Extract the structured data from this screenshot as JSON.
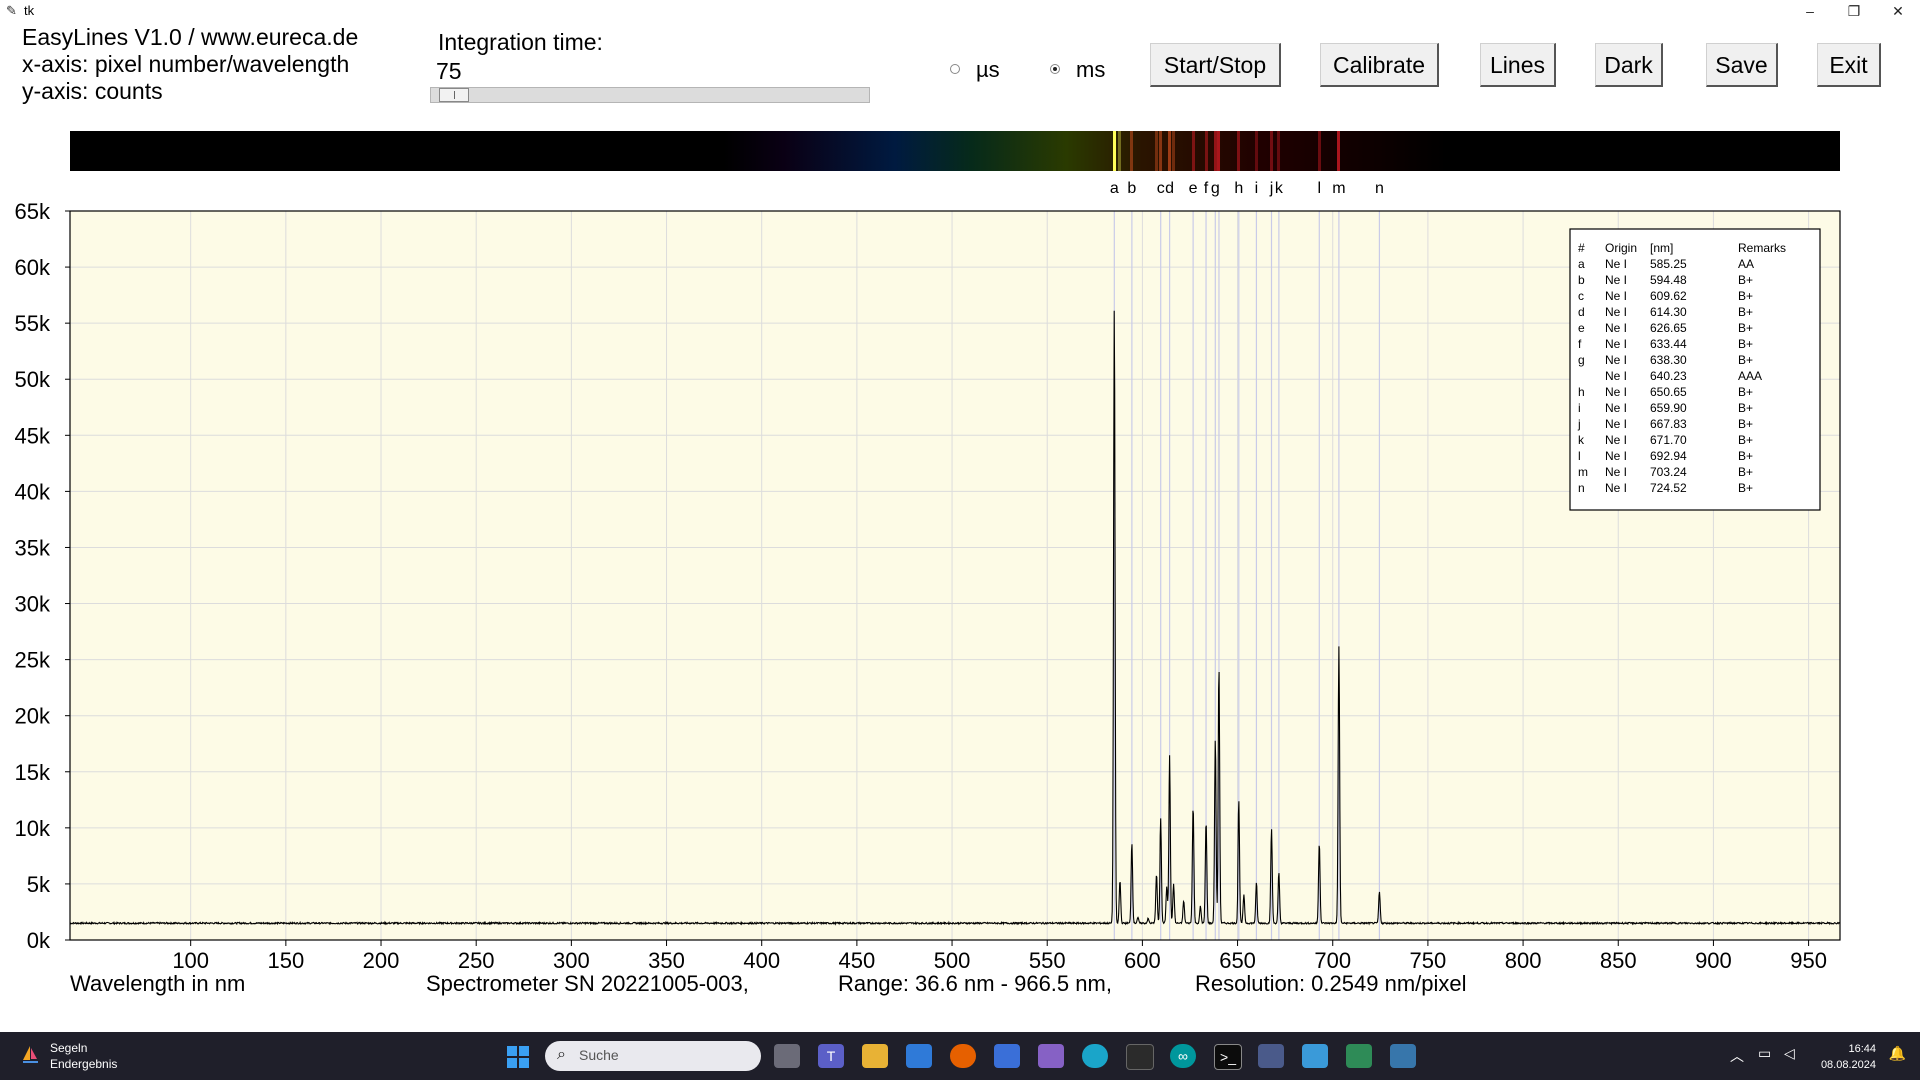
{
  "window": {
    "title": "tk"
  },
  "info": {
    "line1": "EasyLines V1.0 / www.eureca.de",
    "line2": "x-axis: pixel number/wavelength",
    "line3": "y-axis: counts"
  },
  "integration": {
    "label": "Integration time:",
    "value": "75",
    "slider_fraction": 0.02
  },
  "units": {
    "us_label": "µs",
    "ms_label": "ms",
    "selected": "ms"
  },
  "buttons": {
    "start_stop": "Start/Stop",
    "calibrate": "Calibrate",
    "lines": "Lines",
    "dark": "Dark",
    "save": "Save",
    "exit": "Exit"
  },
  "footer": {
    "xlabel": "Wavelength in nm",
    "spectrometer": "Spectrometer SN 20221005-003,",
    "range": "Range: 36.6 nm - 966.5 nm,",
    "resolution": "Resolution: 0.2549 nm/pixel"
  },
  "chart_data": {
    "type": "line",
    "xlabel": "Wavelength in nm",
    "ylabel": "",
    "xlim": [
      36.6,
      966.5
    ],
    "ylim": [
      0,
      65000
    ],
    "xticks": [
      100,
      150,
      200,
      250,
      300,
      350,
      400,
      450,
      500,
      550,
      600,
      650,
      700,
      750,
      800,
      850,
      900,
      950
    ],
    "yticks": [
      0,
      5000,
      10000,
      15000,
      20000,
      25000,
      30000,
      35000,
      40000,
      45000,
      50000,
      55000,
      60000,
      65000
    ],
    "ytick_labels": [
      "0k",
      "5k",
      "10k",
      "15k",
      "20k",
      "25k",
      "30k",
      "35k",
      "40k",
      "45k",
      "50k",
      "55k",
      "60k",
      "65k"
    ],
    "grid": true,
    "baseline": 1500,
    "peaks": [
      {
        "x": 585.25,
        "y": 56500
      },
      {
        "x": 588.2,
        "y": 5300
      },
      {
        "x": 594.48,
        "y": 8700
      },
      {
        "x": 597.6,
        "y": 2000
      },
      {
        "x": 603.0,
        "y": 1900
      },
      {
        "x": 607.4,
        "y": 5900
      },
      {
        "x": 609.62,
        "y": 10900
      },
      {
        "x": 612.8,
        "y": 4800
      },
      {
        "x": 614.3,
        "y": 16500
      },
      {
        "x": 616.4,
        "y": 5000
      },
      {
        "x": 621.7,
        "y": 3500
      },
      {
        "x": 626.65,
        "y": 12000
      },
      {
        "x": 630.5,
        "y": 3000
      },
      {
        "x": 633.44,
        "y": 10600
      },
      {
        "x": 638.3,
        "y": 18000
      },
      {
        "x": 640.23,
        "y": 24500
      },
      {
        "x": 650.65,
        "y": 12500
      },
      {
        "x": 653.3,
        "y": 4000
      },
      {
        "x": 659.9,
        "y": 5100
      },
      {
        "x": 667.83,
        "y": 9900
      },
      {
        "x": 671.7,
        "y": 6000
      },
      {
        "x": 692.94,
        "y": 8700
      },
      {
        "x": 703.24,
        "y": 26200
      },
      {
        "x": 724.52,
        "y": 4300
      }
    ],
    "markers": [
      {
        "label": "a",
        "x": 585.25
      },
      {
        "label": "b",
        "x": 594.48
      },
      {
        "label": "c",
        "x": 609.62
      },
      {
        "label": "d",
        "x": 614.3
      },
      {
        "label": "e",
        "x": 626.65
      },
      {
        "label": "f",
        "x": 633.44
      },
      {
        "label": "g",
        "x": 638.3
      },
      {
        "label": "",
        "x": 640.23
      },
      {
        "label": "h",
        "x": 650.65
      },
      {
        "label": "i",
        "x": 659.9
      },
      {
        "label": "j",
        "x": 667.83
      },
      {
        "label": "k",
        "x": 671.7
      },
      {
        "label": "l",
        "x": 692.94
      },
      {
        "label": "m",
        "x": 703.24
      },
      {
        "label": "n",
        "x": 724.52
      }
    ],
    "line_table": {
      "headers": [
        "#",
        "Origin",
        "[nm]",
        "Remarks"
      ],
      "rows": [
        [
          "a",
          "Ne I",
          "585.25",
          "AA"
        ],
        [
          "b",
          "Ne I",
          "594.48",
          "B+"
        ],
        [
          "c",
          "Ne I",
          "609.62",
          "B+"
        ],
        [
          "d",
          "Ne I",
          "614.30",
          "B+"
        ],
        [
          "e",
          "Ne I",
          "626.65",
          "B+"
        ],
        [
          "f",
          "Ne I",
          "633.44",
          "B+"
        ],
        [
          "g",
          "Ne I",
          "638.30",
          "B+"
        ],
        [
          "",
          "Ne I",
          "640.23",
          "AAA"
        ],
        [
          "h",
          "Ne I",
          "650.65",
          "B+"
        ],
        [
          "i",
          "Ne I",
          "659.90",
          "B+"
        ],
        [
          "j",
          "Ne I",
          "667.83",
          "B+"
        ],
        [
          "k",
          "Ne I",
          "671.70",
          "B+"
        ],
        [
          "l",
          "Ne I",
          "692.94",
          "B+"
        ],
        [
          "m",
          "Ne I",
          "703.24",
          "B+"
        ],
        [
          "n",
          "Ne I",
          "724.52",
          "B+"
        ]
      ]
    },
    "colors": {
      "plot_background": "#fdfbe6",
      "marker_line": "#c9cbe8",
      "trace": "#000000"
    }
  },
  "taskbar": {
    "weather_title": "Segeln",
    "weather_sub": "Endergebnis",
    "search_placeholder": "Suche",
    "time": "16:44",
    "date": "08.08.2024"
  }
}
